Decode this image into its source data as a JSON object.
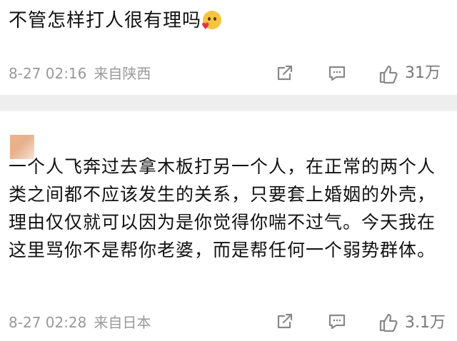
{
  "comments": [
    {
      "text": "不管怎样打人很有理吗",
      "emoji_icon": "smiling-face-with-heart-icon",
      "time": "8-27 02:16",
      "location": "来自陕西",
      "likes": "31万",
      "icons": [
        "share-icon",
        "reply-icon",
        "like-icon"
      ]
    },
    {
      "text": "一个人飞奔过去拿木板打另一个人，在正常的两个人类之间都不应该发生的关系，只要套上婚姻的外壳，理由仅仅就可以因为是你觉得你喘不过气。今天我在这里骂你不是帮你老婆，而是帮任何一个弱势群体。",
      "time": "8-27 02:28",
      "location": "来自日本",
      "likes": "3.1万",
      "icons": [
        "share-icon",
        "reply-icon",
        "like-icon"
      ]
    }
  ],
  "colors": {
    "text": "#111111",
    "meta": "#999999",
    "icon": "#888888",
    "separator": "#eeeeee"
  }
}
